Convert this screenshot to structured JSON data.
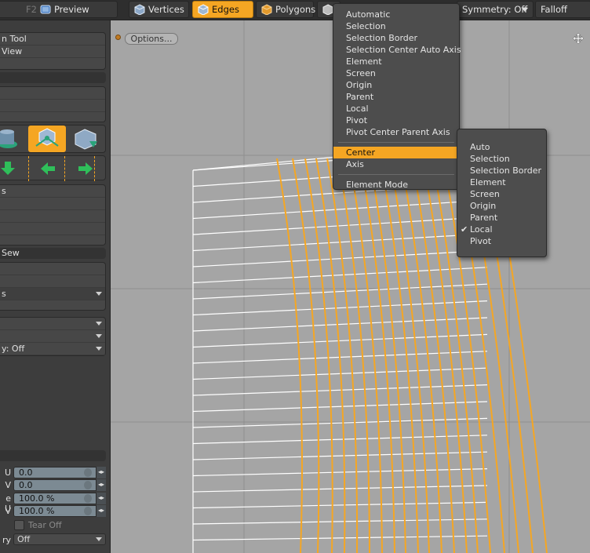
{
  "toolbar": {
    "f2": "F2",
    "preview": "Preview",
    "vertices": "Vertices",
    "edges": "Edges",
    "polygons": "Polygons",
    "symmetry": "Symmetry: Off",
    "falloff": "Falloff",
    "accent": "#f5a623"
  },
  "sidebar": {
    "tool_rows": [
      "n Tool",
      " View",
      ""
    ],
    "list_rows": [
      "s",
      "",
      "",
      "",
      ""
    ],
    "sew_header": " Sew",
    "sew_dropdown": "s",
    "dd1": "",
    "dd2": "",
    "dd3": "y: Off",
    "u_label": "U",
    "v_label": "V",
    "u_value": "0.0",
    "v_value": "0.0",
    "su_label": "e U",
    "sv_label": "V",
    "su_value": "100.0 %",
    "sv_value": "100.0 %",
    "tear_off": "Tear Off",
    "symmetry_label": "ry",
    "symmetry_value": "Off"
  },
  "viewport": {
    "options": "Options..."
  },
  "action_center_menu": {
    "items": [
      "Automatic",
      "Selection",
      "Selection Border",
      "Selection Center Auto Axis",
      "Element",
      "Screen",
      "Origin",
      "Parent",
      "Local",
      "Pivot",
      "Pivot Center Parent Axis"
    ],
    "center": "Center",
    "axis": "Axis",
    "element_mode": "Element Mode"
  },
  "center_submenu": {
    "items": [
      "Auto",
      "Selection",
      "Selection Border",
      "Element",
      "Screen",
      "Origin",
      "Parent",
      "Local",
      "Pivot"
    ],
    "checked": "Local",
    "check_glyph": "✔"
  }
}
